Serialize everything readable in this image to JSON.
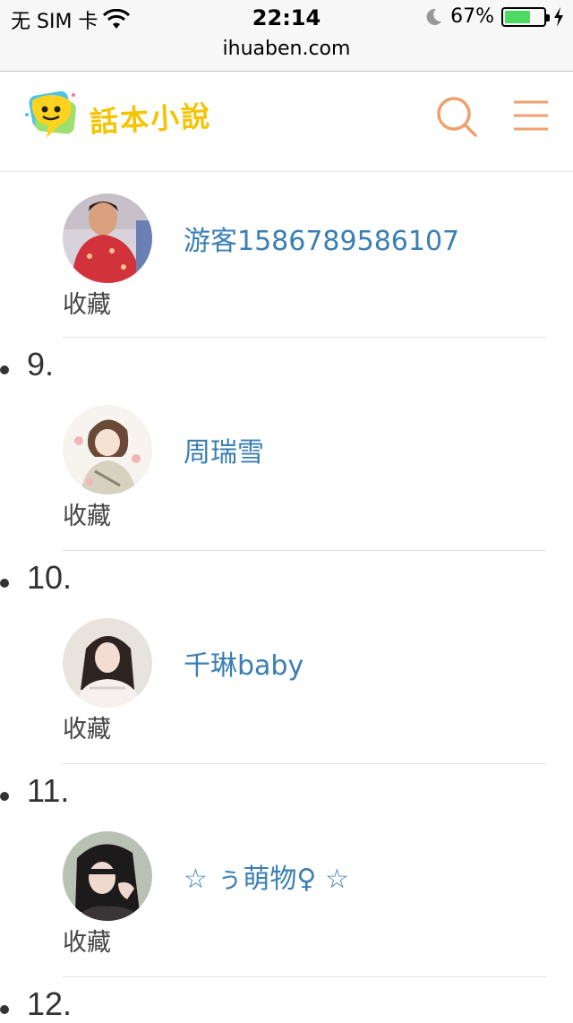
{
  "status_bar": {
    "carrier": "无 SIM 卡",
    "time": "22:14",
    "battery_percent_label": "67%",
    "battery_level": 0.67,
    "battery_color": "#4cd964"
  },
  "url_bar": {
    "host": "ihuaben.com"
  },
  "header": {
    "logo_text": "話本小說",
    "logo_color": "#f5c400",
    "icon_color": "#f0a06e",
    "search_icon": "search-icon",
    "menu_icon": "menu-icon"
  },
  "entries": [
    {
      "number": "",
      "username": "游客1586789586107",
      "action": "收藏",
      "avatar": "avatar-red-dress"
    },
    {
      "number": "9.",
      "username": "周瑞雪",
      "action": "收藏",
      "avatar": "avatar-illustration"
    },
    {
      "number": "10.",
      "username": "千琳baby",
      "action": "收藏",
      "avatar": "avatar-girl-white"
    },
    {
      "number": "11.",
      "username": "☆ ぅ萌物♀ ☆",
      "action": "收藏",
      "avatar": "avatar-girl-dark"
    },
    {
      "number": "12.",
      "username": "",
      "action": "",
      "avatar": ""
    }
  ],
  "link_color": "#3a7fb4"
}
